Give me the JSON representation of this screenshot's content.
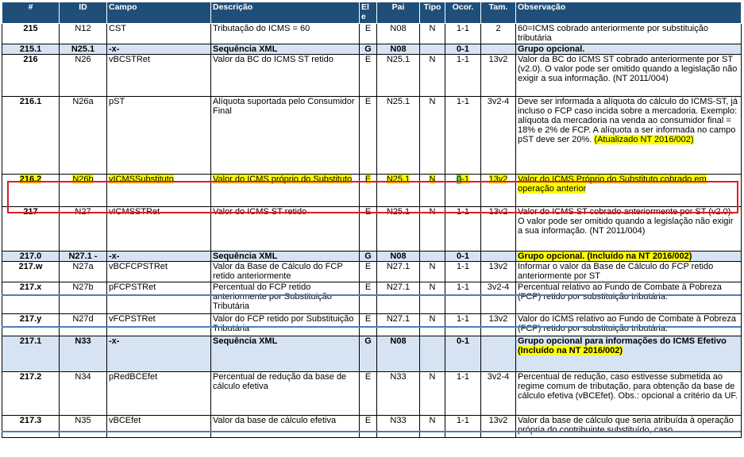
{
  "headers": {
    "num": "#",
    "id": "ID",
    "campo": "Campo",
    "descricao": "Descrição",
    "ele": "El e",
    "pai": "Pai",
    "tipo": "Tipo",
    "ocor": "Ocor.",
    "tam": "Tam.",
    "obs": "Observação"
  },
  "rows": [
    {
      "num": "215",
      "id": "N12",
      "campo": "CST",
      "desc": "Tributação do ICMS = 60",
      "ele": "E",
      "pai": "N08",
      "tipo": "N",
      "ocor": "1-1",
      "tam": "2",
      "obs": "60=ICMS cobrado anteriormente por substituição tributária"
    },
    {
      "num": "215.1",
      "id": "N25.1",
      "campo": "-x-",
      "desc": "Sequência XML",
      "ele": "G",
      "pai": "N08",
      "tipo": "",
      "ocor": "0-1",
      "tam": "",
      "obs": "Grupo opcional."
    },
    {
      "num": "216",
      "id": "N26",
      "campo": "vBCSTRet",
      "desc": "Valor da BC do ICMS ST retido",
      "ele": "E",
      "pai": "N25.1",
      "tipo": "N",
      "ocor": "1-1",
      "tam": "13v2",
      "obs": "Valor da BC do ICMS ST cobrado anteriormente por ST (v2.0). O valor pode ser omitido quando a legislação não exigir a sua informação. (NT 2011/004)"
    },
    {
      "num": "216.1",
      "id": "N26a",
      "campo": "pST",
      "desc": "Alíquota suportada pelo Consumidor Final",
      "ele": "E",
      "pai": "N25.1",
      "tipo": "N",
      "ocor": "1-1",
      "tam": "3v2-4",
      "obs": "Deve ser informada a alíquota do cálculo do ICMS-ST, já incluso o FCP caso incida sobre a mercadoria. Exemplo: alíquota da mercadoria na venda ao consumidor final = 18% e 2% de FCP. A alíquota a ser informada no campo pST deve ser 20%.",
      "obs_note": "(Atualizado NT 2016/002)"
    },
    {
      "num": "216.2",
      "id": "N26b",
      "campo": "vICMSSubstituto",
      "desc": "Valor do ICMS próprio do Substituto",
      "ele": "E",
      "pai": "N25.1",
      "tipo": "N",
      "ocor_a": "0",
      "ocor_b": "-1",
      "tam": "13v2",
      "obs": "Valor do ICMS Próprio do Substituto cobrado em operação anterior"
    },
    {
      "num": "217",
      "id": "N27",
      "campo": "vICMSSTRet",
      "desc": "Valor do ICMS ST retido",
      "ele": "E",
      "pai": "N25.1",
      "tipo": "N",
      "ocor": "1-1",
      "tam": "13v2",
      "obs": "Valor do ICMS ST cobrado anteriormente por ST (v2.0). O valor pode ser omitido quando a legislação não exigir a sua informação. (NT 2011/004)"
    },
    {
      "num": "217.0",
      "id": "N27.1 -",
      "campo": "-x-",
      "desc": "Sequência XML",
      "ele": "G",
      "pai": "N08",
      "tipo": "",
      "ocor": "0-1",
      "tam": "",
      "obs": "Grupo opcional. (Incluído na NT 2016/002)"
    },
    {
      "num": "217.w",
      "id": "N27a",
      "campo": "vBCFCPSTRet",
      "desc": "Valor da Base de Cálculo do FCP retido anteriormente",
      "ele": "E",
      "pai": "N27.1",
      "tipo": "N",
      "ocor": "1-1",
      "tam": "13v2",
      "obs": "Informar o valor da Base de Cálculo do FCP retido anteriormente por ST"
    },
    {
      "num": "217.x",
      "id": "N27b",
      "campo": "pFCPSTRet",
      "desc": "Percentual do FCP retido anteriormente por Substituição Tributária",
      "ele": "E",
      "pai": "N27.1",
      "tipo": "N",
      "ocor": "1-1",
      "tam": "3v2-4",
      "obs": "Percentual relativo ao Fundo de Combate à Pobreza (FCP) retido por substituição tributária."
    },
    {
      "num": "217.y",
      "id": "N27d",
      "campo": "vFCPSTRet",
      "desc": "Valor do FCP retido por Substituição Tributária",
      "ele": "E",
      "pai": "N27.1",
      "tipo": "N",
      "ocor": "1-1",
      "tam": "13v2",
      "obs": "Valor do ICMS relativo ao Fundo de Combate à Pobreza (FCP) retido por substituição tributária."
    },
    {
      "num": "217.1",
      "id": "N33",
      "campo": "-x-",
      "desc": "Sequência XML",
      "ele": "G",
      "pai": "N08",
      "tipo": "",
      "ocor": "0-1",
      "tam": "",
      "obs": "Grupo opcional para informações do ICMS Efetivo",
      "obs_note": "(Incluído na NT 2016/002)"
    },
    {
      "num": "217.2",
      "id": "N34",
      "campo": "pRedBCEfet",
      "desc": "Percentual de redução da base de cálculo efetiva",
      "ele": "E",
      "pai": "N33",
      "tipo": "N",
      "ocor": "1-1",
      "tam": "3v2-4",
      "obs": "Percentual de redução, caso estivesse submetida ao regime comum de tributação, para obtenção da base de cálculo efetiva (vBCEfet). Obs.: opcional a critério da UF."
    },
    {
      "num": "217.3",
      "id": "N35",
      "campo": "vBCEfet",
      "desc": "Valor da base de cálculo efetiva",
      "ele": "E",
      "pai": "N33",
      "tipo": "N",
      "ocor": "1-1",
      "tam": "13v2",
      "obs": "Valor da base de cálculo que seria atribuída à operação própria do contribuinte substituído, caso"
    }
  ]
}
